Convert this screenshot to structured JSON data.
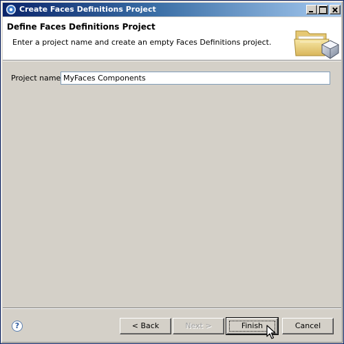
{
  "window": {
    "title": "Create Faces Definitions Project",
    "title_icon": "eclipse-icon",
    "controls": [
      "minimize-icon",
      "maximize-icon",
      "close-icon"
    ]
  },
  "header": {
    "title": "Define Faces Definitions Project",
    "description": "Enter a project name and create an empty Faces Definitions project.",
    "graphic": "folder-wizard-icon"
  },
  "form": {
    "project_name_label": "Project name:",
    "project_name_value": "MyFaces Components"
  },
  "buttons": {
    "help": "?",
    "back": "< Back",
    "next": "Next >",
    "finish": "Finish",
    "cancel": "Cancel"
  },
  "colors": {
    "titlebar_start": "#0a246a",
    "titlebar_end": "#a6caf0",
    "dialog_bg": "#d4d0c8",
    "disabled_text": "#a0a0a0"
  }
}
